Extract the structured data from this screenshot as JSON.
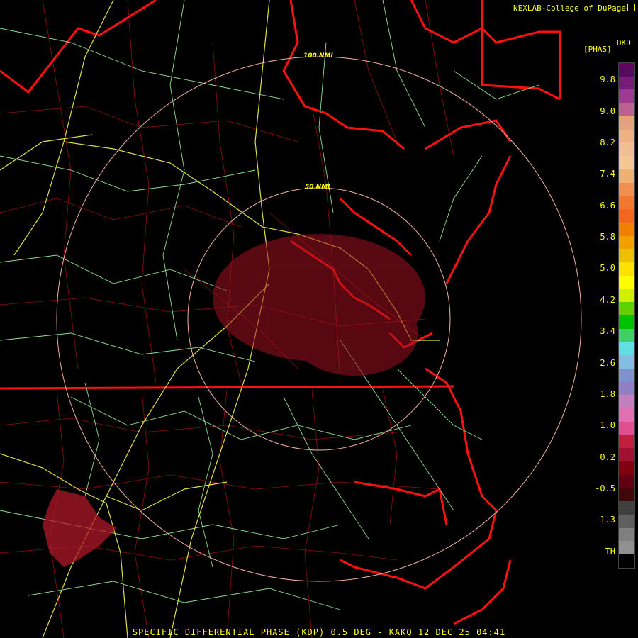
{
  "credit": "NEXLAB-College of DuPage",
  "legend": {
    "unit_top": "DKD",
    "unit_bottom": "[PHAS]",
    "labels": [
      "9.8",
      "9.0",
      "8.2",
      "7.4",
      "6.6",
      "5.8",
      "5.0",
      "4.2",
      "3.4",
      "2.6",
      "1.8",
      "1.0",
      "0.2",
      "-0.5",
      "-1.3",
      "TH"
    ],
    "colors": [
      "#5a0a5a",
      "#7a1a7a",
      "#a03a90",
      "#c06090",
      "#e8a080",
      "#f0b080",
      "#f0c090",
      "#f0c890",
      "#f0b070",
      "#f09050",
      "#f07830",
      "#f06820",
      "#f08000",
      "#f0a000",
      "#f0c000",
      "#ffe000",
      "#ffff00",
      "#d0f000",
      "#60d000",
      "#00c000",
      "#40d060",
      "#60e0e0",
      "#80c0e0",
      "#8090d0",
      "#9080c0",
      "#c080c0",
      "#e070b0",
      "#e05090",
      "#c02040",
      "#a01030",
      "#800010",
      "#600010",
      "#400808",
      "#404040",
      "#606060",
      "#808080",
      "#909090",
      "#000000"
    ]
  },
  "rings": [
    "100 NMI",
    "50 NMI"
  ],
  "footer": "SPECIFIC DIFFERENTIAL PHASE (KDP) 0.5 DEG - KAKQ 12 DEC 25 04:41"
}
